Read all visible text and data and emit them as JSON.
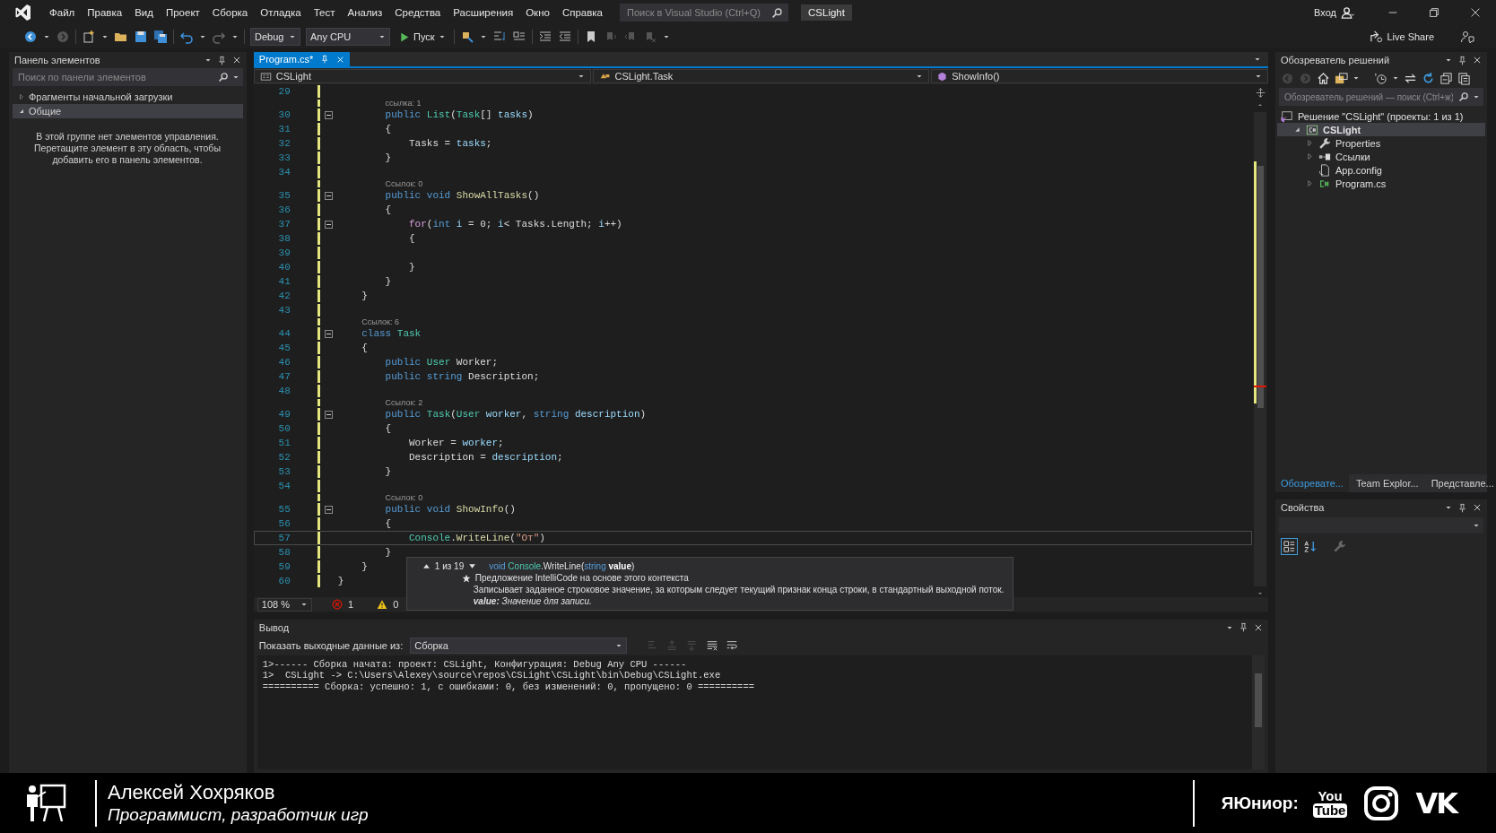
{
  "title_bar": {
    "menu": [
      "Файл",
      "Правка",
      "Вид",
      "Проект",
      "Сборка",
      "Отладка",
      "Тест",
      "Анализ",
      "Средства",
      "Расширения",
      "Окно",
      "Справка"
    ],
    "search": {
      "placeholder": "Поиск в Visual Studio (Ctrl+Q)"
    },
    "solution_name": "CSLight",
    "sign_in": "Вход"
  },
  "toolbar": {
    "configuration": "Debug",
    "platform": "Any CPU",
    "start": "Пуск",
    "live_share": "Live Share"
  },
  "toolbox": {
    "title": "Панель элементов",
    "search": {
      "placeholder": "Поиск по панели элементов"
    },
    "groups": [
      {
        "label": "Фрагменты начальной загрузки",
        "expanded": false,
        "selected": false
      },
      {
        "label": "Общие",
        "expanded": true,
        "selected": true
      }
    ],
    "empty_message": "В этой группе нет элементов управления. Перетащите элемент в эту область, чтобы добавить его в панель элементов."
  },
  "editor": {
    "tabs": [
      {
        "label": "Program.cs*",
        "selected": true
      }
    ],
    "navigation": [
      "CSLight",
      "CSLight.Task",
      "ShowInfo()"
    ],
    "lines": [
      {
        "kind": "code",
        "number": "29",
        "fold": false,
        "current": false
      },
      {
        "kind": "lens",
        "text": "ссылка: 1"
      },
      {
        "kind": "code",
        "number": "30",
        "fold": true,
        "current": false,
        "tokens": [
          {
            "kind": "kw",
            "text": "        public "
          },
          {
            "kind": "type",
            "text": "List"
          },
          {
            "kind": "p",
            "text": "("
          },
          {
            "kind": "type",
            "text": "Task"
          },
          {
            "kind": "p",
            "text": "[] "
          },
          {
            "kind": "var",
            "text": "tasks"
          },
          {
            "kind": "p",
            "text": ")"
          }
        ]
      },
      {
        "kind": "code",
        "number": "31",
        "fold": false,
        "current": false,
        "tokens": [
          {
            "kind": "p",
            "text": "        {"
          }
        ]
      },
      {
        "kind": "code",
        "number": "32",
        "fold": false,
        "current": false,
        "tokens": [
          {
            "kind": "p",
            "text": "            Tasks = "
          },
          {
            "kind": "var",
            "text": "tasks"
          },
          {
            "kind": "p",
            "text": ";"
          }
        ]
      },
      {
        "kind": "code",
        "number": "33",
        "fold": false,
        "current": false,
        "tokens": [
          {
            "kind": "p",
            "text": "        }"
          }
        ]
      },
      {
        "kind": "code",
        "number": "34",
        "fold": false,
        "current": false
      },
      {
        "kind": "lens",
        "text": "Ссылок: 0"
      },
      {
        "kind": "code",
        "number": "35",
        "fold": true,
        "current": false,
        "tokens": [
          {
            "kind": "kw",
            "text": "        public void "
          },
          {
            "kind": "method",
            "text": "ShowAllTasks"
          },
          {
            "kind": "p",
            "text": "()"
          }
        ]
      },
      {
        "kind": "code",
        "number": "36",
        "fold": false,
        "current": false,
        "tokens": [
          {
            "kind": "p",
            "text": "        {"
          }
        ]
      },
      {
        "kind": "code",
        "number": "37",
        "fold": true,
        "current": false,
        "tokens": [
          {
            "kind": "ctl",
            "text": "            for"
          },
          {
            "kind": "p",
            "text": "("
          },
          {
            "kind": "kw",
            "text": "int "
          },
          {
            "kind": "var",
            "text": "i"
          },
          {
            "kind": "p",
            "text": " = 0; "
          },
          {
            "kind": "var",
            "text": "i"
          },
          {
            "kind": "p",
            "text": "< Tasks.Length; "
          },
          {
            "kind": "var",
            "text": "i"
          },
          {
            "kind": "p",
            "text": "++)"
          }
        ]
      },
      {
        "kind": "code",
        "number": "38",
        "fold": false,
        "current": false,
        "tokens": [
          {
            "kind": "p",
            "text": "            {"
          }
        ]
      },
      {
        "kind": "code",
        "number": "39",
        "fold": false,
        "current": false
      },
      {
        "kind": "code",
        "number": "40",
        "fold": false,
        "current": false,
        "tokens": [
          {
            "kind": "p",
            "text": "            }"
          }
        ]
      },
      {
        "kind": "code",
        "number": "41",
        "fold": false,
        "current": false,
        "tokens": [
          {
            "kind": "p",
            "text": "        }"
          }
        ]
      },
      {
        "kind": "code",
        "number": "42",
        "fold": false,
        "current": false,
        "tokens": [
          {
            "kind": "p",
            "text": "    }"
          }
        ]
      },
      {
        "kind": "code",
        "number": "43",
        "fold": false,
        "current": false
      },
      {
        "kind": "lens",
        "text": "Ссылок: 6"
      },
      {
        "kind": "code",
        "number": "44",
        "fold": true,
        "current": false,
        "tokens": [
          {
            "kind": "kw",
            "text": "    class "
          },
          {
            "kind": "type",
            "text": "Task"
          }
        ]
      },
      {
        "kind": "code",
        "number": "45",
        "fold": false,
        "current": false,
        "tokens": [
          {
            "kind": "p",
            "text": "    {"
          }
        ]
      },
      {
        "kind": "code",
        "number": "46",
        "fold": false,
        "current": false,
        "tokens": [
          {
            "kind": "kw",
            "text": "        public "
          },
          {
            "kind": "type",
            "text": "User"
          },
          {
            "kind": "p",
            "text": " Worker;"
          }
        ]
      },
      {
        "kind": "code",
        "number": "47",
        "fold": false,
        "current": false,
        "tokens": [
          {
            "kind": "kw",
            "text": "        public string"
          },
          {
            "kind": "p",
            "text": " Description;"
          }
        ]
      },
      {
        "kind": "code",
        "number": "48",
        "fold": false,
        "current": false
      },
      {
        "kind": "lens",
        "text": "Ссылок: 2"
      },
      {
        "kind": "code",
        "number": "49",
        "fold": true,
        "current": false,
        "tokens": [
          {
            "kind": "kw",
            "text": "        public "
          },
          {
            "kind": "type",
            "text": "Task"
          },
          {
            "kind": "p",
            "text": "("
          },
          {
            "kind": "type",
            "text": "User "
          },
          {
            "kind": "var",
            "text": "worker"
          },
          {
            "kind": "p",
            "text": ", "
          },
          {
            "kind": "kw",
            "text": "string "
          },
          {
            "kind": "var",
            "text": "description"
          },
          {
            "kind": "p",
            "text": ")"
          }
        ]
      },
      {
        "kind": "code",
        "number": "50",
        "fold": false,
        "current": false,
        "tokens": [
          {
            "kind": "p",
            "text": "        {"
          }
        ]
      },
      {
        "kind": "code",
        "number": "51",
        "fold": false,
        "current": false,
        "tokens": [
          {
            "kind": "p",
            "text": "            Worker = "
          },
          {
            "kind": "var",
            "text": "worker"
          },
          {
            "kind": "p",
            "text": ";"
          }
        ]
      },
      {
        "kind": "code",
        "number": "52",
        "fold": false,
        "current": false,
        "tokens": [
          {
            "kind": "p",
            "text": "            Description = "
          },
          {
            "kind": "var",
            "text": "description"
          },
          {
            "kind": "p",
            "text": ";"
          }
        ]
      },
      {
        "kind": "code",
        "number": "53",
        "fold": false,
        "current": false,
        "tokens": [
          {
            "kind": "p",
            "text": "        }"
          }
        ]
      },
      {
        "kind": "code",
        "number": "54",
        "fold": false,
        "current": false
      },
      {
        "kind": "lens",
        "text": "Ссылок: 0"
      },
      {
        "kind": "code",
        "number": "55",
        "fold": true,
        "current": false,
        "tokens": [
          {
            "kind": "kw",
            "text": "        public void "
          },
          {
            "kind": "method",
            "text": "ShowInfo"
          },
          {
            "kind": "p",
            "text": "()"
          }
        ]
      },
      {
        "kind": "code",
        "number": "56",
        "fold": false,
        "current": false,
        "tokens": [
          {
            "kind": "p",
            "text": "        {"
          }
        ]
      },
      {
        "kind": "code",
        "number": "57",
        "fold": false,
        "current": true,
        "tokens": [
          {
            "kind": "type",
            "text": "            Console"
          },
          {
            "kind": "p",
            "text": "."
          },
          {
            "kind": "method",
            "text": "WriteLine"
          },
          {
            "kind": "p",
            "text": "("
          },
          {
            "kind": "str",
            "text": "\"От\""
          },
          {
            "kind": "p",
            "text": ")"
          }
        ]
      },
      {
        "kind": "code",
        "number": "58",
        "fold": false,
        "current": false,
        "tokens": [
          {
            "kind": "p",
            "text": "        }"
          }
        ]
      },
      {
        "kind": "code",
        "number": "59",
        "fold": false,
        "current": false,
        "tokens": [
          {
            "kind": "p",
            "text": "    }"
          }
        ]
      },
      {
        "kind": "code",
        "number": "60",
        "fold": false,
        "current": false,
        "tokens": [
          {
            "kind": "p",
            "text": "}"
          }
        ]
      }
    ],
    "zoom": "108 %",
    "errors": "1",
    "warnings": "0",
    "tooltip": {
      "counter": "1 из 19",
      "signature": [
        {
          "kind": "kw",
          "text": "void "
        },
        {
          "kind": "type",
          "text": "Console"
        },
        {
          "kind": "p",
          "text": ".WriteLine("
        },
        {
          "kind": "kw",
          "text": "string "
        },
        {
          "kind": "param",
          "text": "value"
        },
        {
          "kind": "p",
          "text": ")"
        }
      ],
      "suggestion": "Предложение IntelliCode на основе этого контекста",
      "description": "Записывает заданное строковое значение, за которым следует текущий признак конца строки, в стандартный выходной поток.",
      "parameter": "**value:** Значение для записи."
    }
  },
  "output": {
    "title": "Вывод",
    "source_label": "Показать выходные данные из:",
    "source": "Сборка",
    "lines": [
      "1>------ Сборка начата: проект: CSLight, Конфигурация: Debug Any CPU ------",
      "1>  CSLight -> C:\\Users\\Alexey\\source\\repos\\CSLight\\CSLight\\bin\\Debug\\CSLight.exe",
      "========== Сборка: успешно: 1, с ошибками: 0, без изменений: 0, пропущено: 0 =========="
    ]
  },
  "solution_explorer": {
    "title": "Обозреватель решений",
    "search": {
      "placeholder": "Обозреватель решений — поиск (Ctrl+ж)"
    },
    "tree": [
      {
        "label": "Решение \"CSLight\" (проекты: 1 из 1)",
        "kind": "solution",
        "selected": false,
        "children": [
          {
            "label": "CSLight",
            "kind": "project",
            "expanded": true,
            "selected": true,
            "children": [
              {
                "label": "Properties",
                "kind": "properties",
                "expanded": false,
                "selected": false
              },
              {
                "label": "Ссылки",
                "kind": "references",
                "expanded": false,
                "selected": false
              },
              {
                "label": "App.config",
                "kind": "config",
                "selected": false
              },
              {
                "label": "Program.cs",
                "kind": "csharp",
                "expanded": false,
                "selected": false
              }
            ]
          }
        ]
      }
    ],
    "tabs": [
      {
        "label": "Обозревате...",
        "selected": true
      },
      {
        "label": "Team Explor...",
        "selected": false
      },
      {
        "label": "Представле...",
        "selected": false
      }
    ]
  },
  "properties": {
    "title": "Свойства"
  },
  "overlay": {
    "name": "Алексей Хохряков",
    "role": "Программист, разработчик игр",
    "channel": "ЯЮниор:",
    "video_logo": [
      "You",
      "Tube"
    ],
    "social_logo": "VK"
  }
}
